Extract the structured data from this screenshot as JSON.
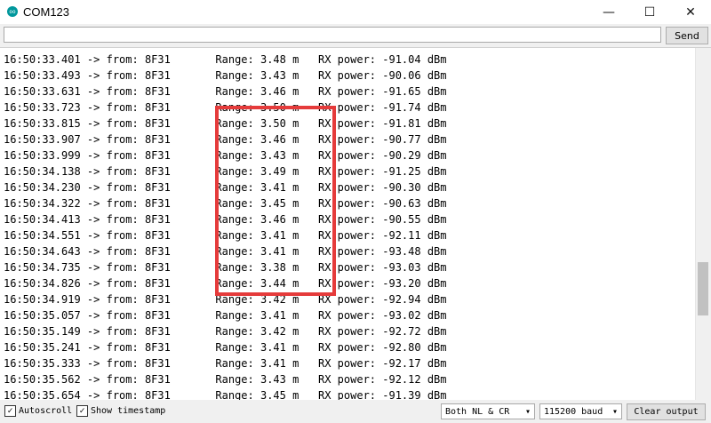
{
  "window": {
    "title": "COM123",
    "icon": "arduino-icon",
    "icon_text": "oo",
    "minimize_glyph": "—",
    "maximize_glyph": "☐",
    "close_glyph": "✕"
  },
  "send": {
    "input_value": "",
    "button_label": "Send"
  },
  "log": [
    "16:50:33.401 -> from: 8F31       Range: 3.48 m   RX power: -91.04 dBm",
    "16:50:33.493 -> from: 8F31       Range: 3.43 m   RX power: -90.06 dBm",
    "16:50:33.631 -> from: 8F31       Range: 3.46 m   RX power: -91.65 dBm",
    "16:50:33.723 -> from: 8F31       Range: 3.50 m   RX power: -91.74 dBm",
    "16:50:33.815 -> from: 8F31       Range: 3.50 m   RX power: -91.81 dBm",
    "16:50:33.907 -> from: 8F31       Range: 3.46 m   RX power: -90.77 dBm",
    "16:50:33.999 -> from: 8F31       Range: 3.43 m   RX power: -90.29 dBm",
    "16:50:34.138 -> from: 8F31       Range: 3.49 m   RX power: -91.25 dBm",
    "16:50:34.230 -> from: 8F31       Range: 3.41 m   RX power: -90.30 dBm",
    "16:50:34.322 -> from: 8F31       Range: 3.45 m   RX power: -90.63 dBm",
    "16:50:34.413 -> from: 8F31       Range: 3.46 m   RX power: -90.55 dBm",
    "16:50:34.551 -> from: 8F31       Range: 3.41 m   RX power: -92.11 dBm",
    "16:50:34.643 -> from: 8F31       Range: 3.41 m   RX power: -93.48 dBm",
    "16:50:34.735 -> from: 8F31       Range: 3.38 m   RX power: -93.03 dBm",
    "16:50:34.826 -> from: 8F31       Range: 3.44 m   RX power: -93.20 dBm",
    "16:50:34.919 -> from: 8F31       Range: 3.42 m   RX power: -92.94 dBm",
    "16:50:35.057 -> from: 8F31       Range: 3.41 m   RX power: -93.02 dBm",
    "16:50:35.149 -> from: 8F31       Range: 3.42 m   RX power: -92.72 dBm",
    "16:50:35.241 -> from: 8F31       Range: 3.41 m   RX power: -92.80 dBm",
    "16:50:35.333 -> from: 8F31       Range: 3.41 m   RX power: -92.17 dBm",
    "16:50:35.562 -> from: 8F31       Range: 3.43 m   RX power: -92.12 dBm",
    "16:50:35.654 -> from: 8F31       Range: 3.45 m   RX power: -91.39 dBm"
  ],
  "status": {
    "autoscroll_label": "Autoscroll",
    "autoscroll_checked": true,
    "timestamp_label": "Show timestamp",
    "timestamp_checked": true,
    "check_glyph": "✓",
    "line_ending": "Both NL & CR",
    "baud": "115200 baud",
    "dropdown_glyph": "▾",
    "clear_label": "Clear output"
  },
  "colors": {
    "highlight": "#e53b3b",
    "arduino_teal": "#00979c"
  }
}
